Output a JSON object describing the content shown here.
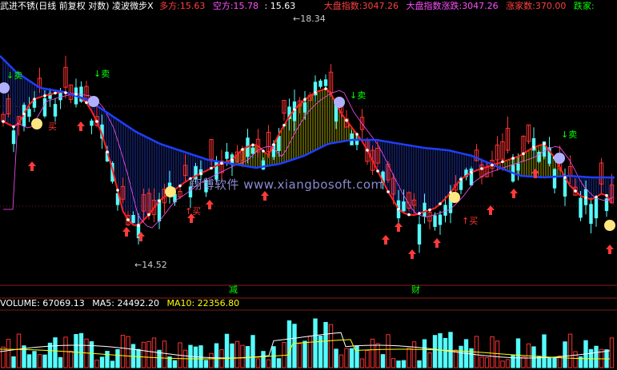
{
  "header": {
    "title": "武进不锈(日线 前复权 对数) 凌波微步X",
    "duo_label": "多方:",
    "duo_value": "15.63",
    "kong_label": "空方:",
    "kong_value": "15.78",
    "close_value": ": 15.63",
    "market_label": "大盘指数:",
    "market_value": "3047.26",
    "market_change_label": "大盘指数涨跌:",
    "market_change_value": "3047.26",
    "up_count_label": "涨家数:",
    "up_count_value": "370.00",
    "down_count_label": "跌家:"
  },
  "price_markers": {
    "high": "18.34",
    "low": "14.52"
  },
  "signals": {
    "sell": "↓卖",
    "buy": "↑买",
    "buy_short": "买"
  },
  "date_markers": {
    "m1": "减",
    "m2": "财"
  },
  "watermark": "翔博软件 www.xiangbosoft.com",
  "volume": {
    "label": "VOLUME: 67069.13",
    "ma5": "MA5: 24492.20",
    "ma10": "MA10: 22356.80"
  },
  "colors": {
    "up": "#ff3232",
    "down": "#54fcfc",
    "ma_blue": "#1f3fff",
    "red_line": "#ff2020",
    "yellow": "#ffff00",
    "magenta": "#ff50ff",
    "sell": "#00ff00",
    "buy": "#ff3232"
  }
}
